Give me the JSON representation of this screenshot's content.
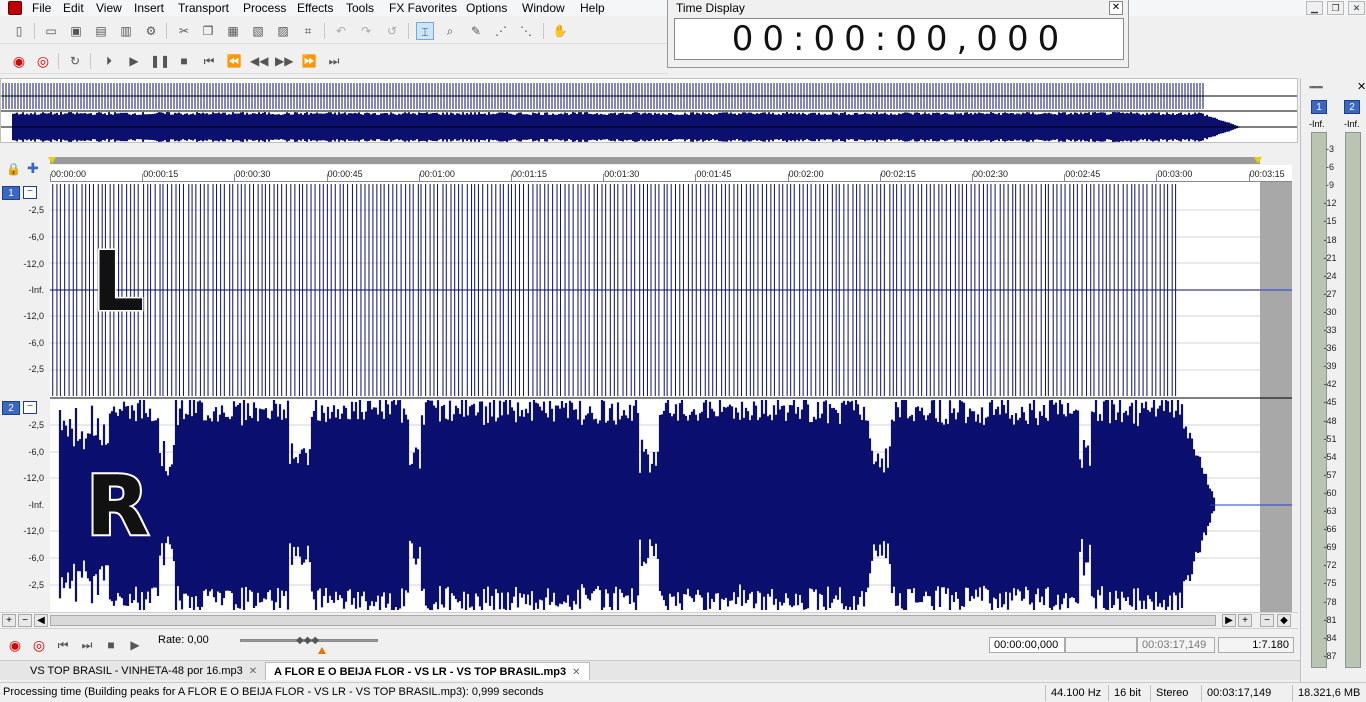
{
  "menu": [
    "File",
    "Edit",
    "View",
    "Insert",
    "Transport",
    "Process",
    "Effects",
    "Tools",
    "FX Favorites",
    "Options",
    "Window",
    "Help"
  ],
  "window_controls": {
    "minimize": "▁",
    "restore": "❐",
    "close": "✕"
  },
  "toolbar_icons": [
    "new-file-icon",
    "open-icon",
    "save-icon",
    "save-as-icon",
    "render-icon",
    "properties-icon",
    "cut-icon",
    "copy-icon",
    "paste-icon",
    "paste-mix-icon",
    "crop-icon",
    "trim-icon",
    "undo-icon",
    "redo-icon",
    "undo-all-icon",
    "edit-tool-icon",
    "magnify-tool-icon",
    "pencil-tool-icon",
    "envelope-tool-icon",
    "marker-tool-icon",
    "hand-icon"
  ],
  "time_display": {
    "title": "Time Display",
    "value": "00:00:00,000",
    "close": "✕"
  },
  "timeline": {
    "labels": [
      "00:00:00",
      "00:00:15",
      "00:00:30",
      "00:00:45",
      "00:01:00",
      "00:01:15",
      "00:01:30",
      "00:01:45",
      "00:02:00",
      "00:02:15",
      "00:02:30",
      "00:02:45",
      "00:03:00",
      "00:03:15"
    ]
  },
  "channels": [
    {
      "number": "1",
      "button": "−",
      "letter": "L",
      "db": [
        "-2,5",
        "-6,0",
        "-12,0",
        "-Inf.",
        "-12,0",
        "-6,0",
        "-2,5"
      ]
    },
    {
      "number": "2",
      "button": "−",
      "letter": "R",
      "db": [
        "-2,5",
        "-6,0",
        "-12,0",
        "-Inf.",
        "-12,0",
        "-6,0",
        "-2,5"
      ]
    }
  ],
  "transport": {
    "rate_label": "Rate: 0,00",
    "cursor_position": "00:00:00,000",
    "selection_length": "",
    "total_length": "00:03:17,149",
    "zoom": "1:7.180"
  },
  "tabs": [
    {
      "label": "VS TOP BRASIL - VINHETA-48 por 16.mp3",
      "close": "✕",
      "active": false
    },
    {
      "label": "A FLOR E O BEIJA FLOR - VS LR - VS TOP BRASIL.mp3",
      "close": "✕",
      "active": true
    }
  ],
  "status": {
    "text": "Processing time (Building peaks for A FLOR E O BEIJA FLOR - VS LR - VS TOP BRASIL.mp3): 0,999 seconds",
    "sample_rate": "44.100 Hz",
    "bit_depth": "16 bit",
    "channels": "Stereo",
    "length": "00:03:17,149",
    "disk_space": "18.321,6 MB"
  },
  "meter": {
    "channels": [
      "1",
      "2"
    ],
    "peak": "-Inf.",
    "scale": [
      "3",
      "6",
      "9",
      "12",
      "15",
      "18",
      "21",
      "24",
      "27",
      "30",
      "33",
      "36",
      "39",
      "42",
      "45",
      "48",
      "51",
      "54",
      "57",
      "60",
      "63",
      "66",
      "69",
      "72",
      "75",
      "78",
      "81",
      "84",
      "87"
    ]
  },
  "colors": {
    "waveform": "#0b0f6e",
    "channel_badge": "#3a66c4",
    "letter_stroke": "#ffffff"
  }
}
